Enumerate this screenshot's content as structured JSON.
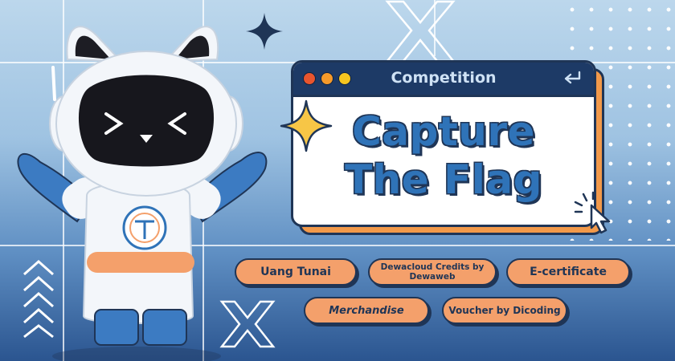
{
  "window": {
    "title": "Competition",
    "headline_line1": "Capture",
    "headline_line2": "The Flag"
  },
  "prizes": [
    {
      "label": "Uang Tunai"
    },
    {
      "label": "Dewacloud Credits by Dewaweb"
    },
    {
      "label": "E-certificate"
    },
    {
      "label": "Merchandise"
    },
    {
      "label": "Voucher by Dicoding"
    }
  ],
  "colors": {
    "navy": "#1f3556",
    "blue": "#2f73b8",
    "orange": "#f4a06b",
    "window_dot_red": "#e8552e",
    "window_dot_orange": "#f59a2a",
    "window_dot_yellow": "#f5c51f"
  },
  "icons": [
    "sparkle-icon",
    "star-icon",
    "cursor-click-icon",
    "back-arrow-icon",
    "chevron-up-icon",
    "x-shape-icon",
    "logo-icon"
  ]
}
